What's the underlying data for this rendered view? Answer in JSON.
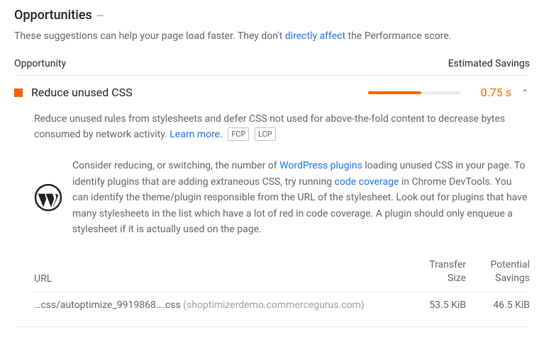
{
  "header": {
    "title": "Opportunities",
    "dash": "—",
    "desc_before": "These suggestions can help your page load faster. They don't ",
    "desc_link": "directly affect",
    "desc_after": " the Performance score."
  },
  "columns": {
    "left": "Opportunity",
    "right": "Estimated Savings"
  },
  "audit": {
    "title": "Reduce unused CSS",
    "savings": "0.75 s",
    "gauge_percent": 58,
    "chevron": "⌃",
    "description_main": "Reduce unused rules from stylesheets and defer CSS not used for above-the-fold content to decrease bytes consumed by network activity. ",
    "learn_more": "Learn more.",
    "badges": [
      "FCP",
      "LCP"
    ],
    "stack": {
      "before_link1": "Consider reducing, or switching, the number of ",
      "link1": "WordPress plugins",
      "between1": " loading unused CSS in your page. To identify plugins that are adding extraneous CSS, try running ",
      "link2": "code coverage",
      "after": " in Chrome DevTools. You can identify the theme/plugin responsible from the URL of the stylesheet. Look out for plugins that have many stylesheets in the list which have a lot of red in code coverage. A plugin should only enqueue a stylesheet if it is actually used on the page."
    },
    "table": {
      "headers": {
        "url": "URL",
        "size_l1": "Transfer",
        "size_l2": "Size",
        "save_l1": "Potential",
        "save_l2": "Savings"
      },
      "rows": [
        {
          "path": "…css/autoptimize_9919868….css",
          "host": "(shoptimizerdemo.commercegurus.com)",
          "size": "53.5 KiB",
          "savings": "46.5 KiB"
        }
      ]
    }
  }
}
